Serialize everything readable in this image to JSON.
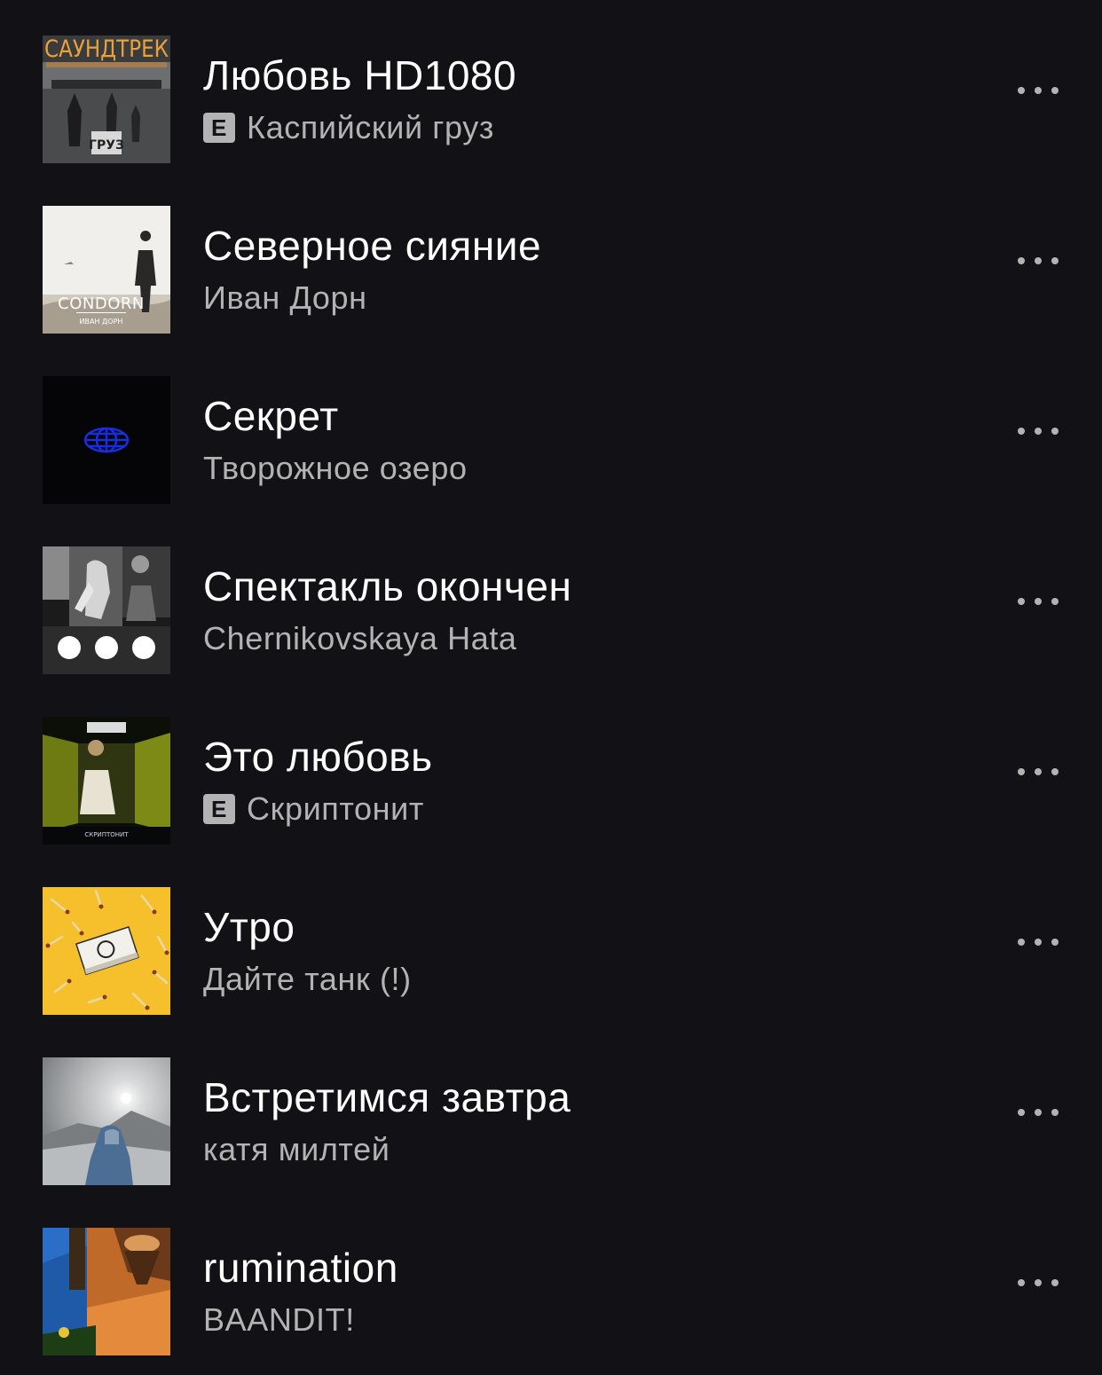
{
  "tracks": [
    {
      "title": "Любовь HD1080",
      "artist": "Каспийский груз",
      "explicit": true,
      "explicit_label": "E",
      "cover_text": "САУНДТРЕК",
      "cover_subtext": "ГРУЗ"
    },
    {
      "title": "Северное сияние",
      "artist": "Иван Дорн",
      "explicit": false,
      "cover_text": "CONDORN",
      "cover_subtext": "ИВАН ДОРН"
    },
    {
      "title": "Секрет",
      "artist": "Творожное озеро",
      "explicit": false
    },
    {
      "title": "Спектакль окончен",
      "artist": "Chernikovskaya Hata",
      "explicit": false
    },
    {
      "title": "Это любовь",
      "artist": "Скриптонит",
      "explicit": true,
      "explicit_label": "E",
      "cover_text": "СКРИПТОНИТ"
    },
    {
      "title": "Утро",
      "artist": "Дайте танк (!)",
      "explicit": false
    },
    {
      "title": "Встретимся завтра",
      "artist": "катя милтей",
      "explicit": false
    },
    {
      "title": "rumination",
      "artist": "BAANDIT!",
      "explicit": false
    }
  ],
  "icons": {
    "more": "more-options-icon",
    "explicit": "explicit-badge"
  },
  "colors": {
    "background": "#121116",
    "title": "#ffffff",
    "secondary": "#b3b3b3"
  }
}
